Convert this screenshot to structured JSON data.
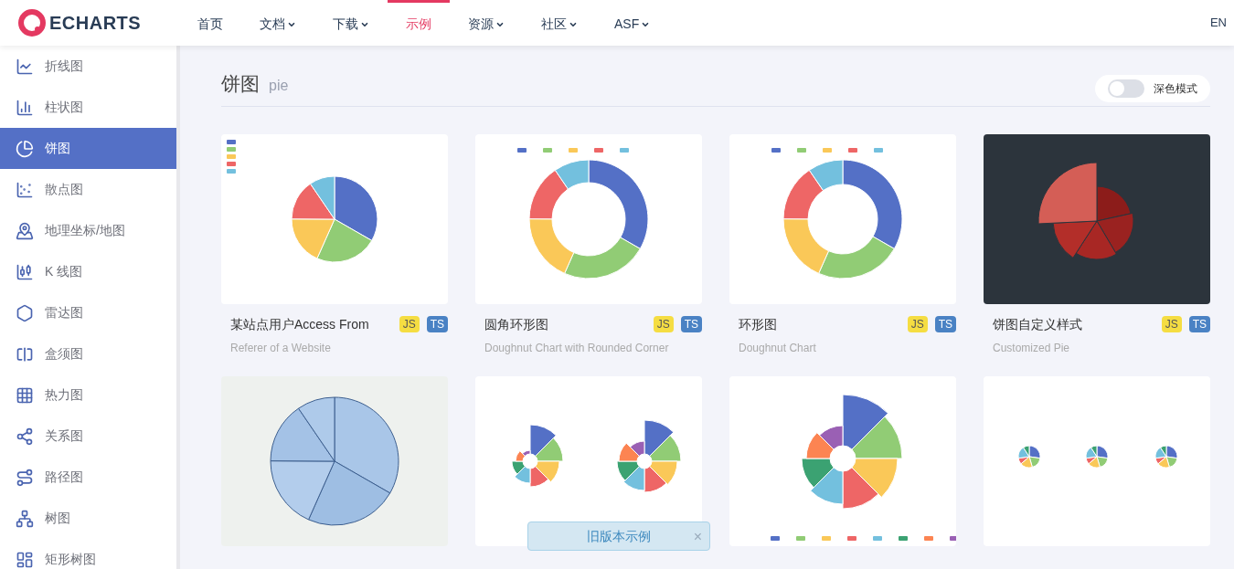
{
  "header": {
    "logo": "ECHARTS",
    "nav": [
      {
        "label": "首页",
        "dropdown": false,
        "selected": false
      },
      {
        "label": "文档",
        "dropdown": true,
        "selected": false
      },
      {
        "label": "下载",
        "dropdown": true,
        "selected": false
      },
      {
        "label": "示例",
        "dropdown": false,
        "selected": true
      },
      {
        "label": "资源",
        "dropdown": true,
        "selected": false
      },
      {
        "label": "社区",
        "dropdown": true,
        "selected": false
      },
      {
        "label": "ASF",
        "dropdown": true,
        "selected": false
      }
    ],
    "language": "EN"
  },
  "sidebar": {
    "items": [
      {
        "label": "折线图",
        "selected": false
      },
      {
        "label": "柱状图",
        "selected": false
      },
      {
        "label": "饼图",
        "selected": true
      },
      {
        "label": "散点图",
        "selected": false
      },
      {
        "label": "地理坐标/地图",
        "selected": false
      },
      {
        "label": "K 线图",
        "selected": false
      },
      {
        "label": "雷达图",
        "selected": false
      },
      {
        "label": "盒须图",
        "selected": false
      },
      {
        "label": "热力图",
        "selected": false
      },
      {
        "label": "关系图",
        "selected": false
      },
      {
        "label": "路径图",
        "selected": false
      },
      {
        "label": "树图",
        "selected": false
      },
      {
        "label": "矩形树图",
        "selected": false
      }
    ]
  },
  "section": {
    "title": "饼图",
    "subtitle": "pie",
    "dark_mode": {
      "label": "深色模式",
      "on": false
    }
  },
  "cards": [
    {
      "kind": "pie-legend",
      "title": "某站点用户Access From",
      "subtitle": "Referer of a Website",
      "badges": [
        {
          "label": "JS",
          "kind": "js"
        },
        {
          "label": "TS",
          "kind": "ts"
        }
      ]
    },
    {
      "kind": "doughnut-rounded",
      "title": "圆角环形图",
      "subtitle": "Doughnut Chart with Rounded Corner",
      "badges": [
        {
          "label": "JS",
          "kind": "js"
        },
        {
          "label": "TS",
          "kind": "ts"
        }
      ]
    },
    {
      "kind": "doughnut",
      "title": "环形图",
      "subtitle": "Doughnut Chart",
      "badges": [
        {
          "label": "JS",
          "kind": "js"
        },
        {
          "label": "TS",
          "kind": "ts"
        }
      ]
    },
    {
      "kind": "custom-dark",
      "title": "饼图自定义样式",
      "subtitle": "Customized Pie",
      "badges": [
        {
          "label": "JS",
          "kind": "js"
        },
        {
          "label": "TS",
          "kind": "ts"
        }
      ]
    },
    {
      "kind": "texture"
    },
    {
      "kind": "nightingale-double"
    },
    {
      "kind": "nightingale"
    },
    {
      "kind": "align"
    }
  ],
  "toast": {
    "label": "旧版本示例",
    "close": "×"
  }
}
